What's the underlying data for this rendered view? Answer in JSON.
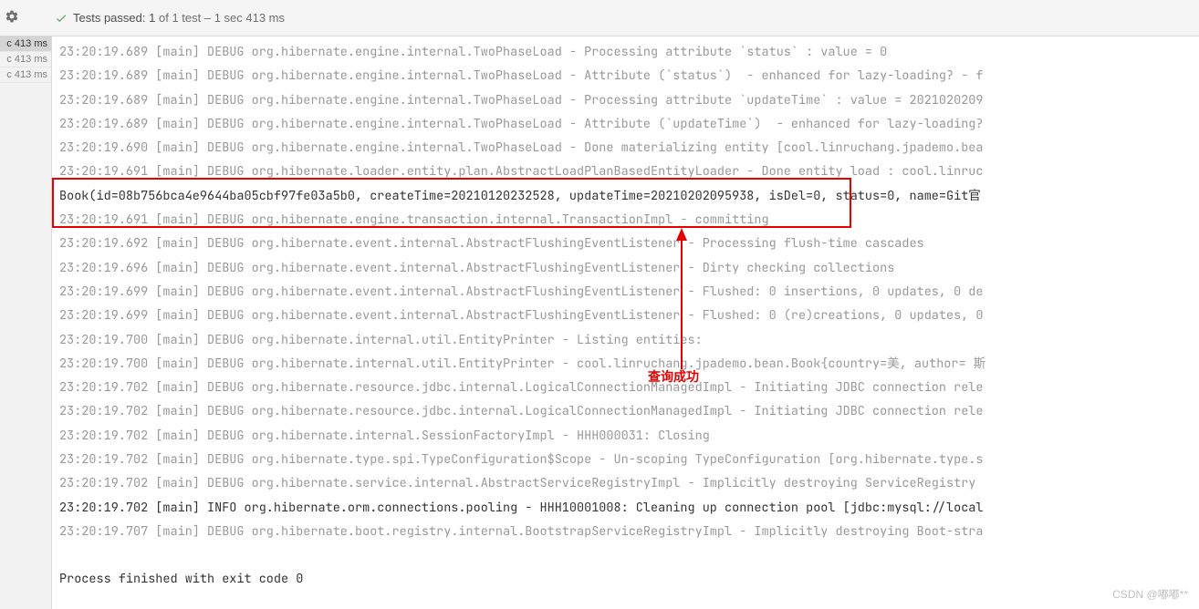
{
  "toolbar": {
    "tests_passed_prefix": "Tests passed:",
    "tests_passed_count": "1",
    "tests_passed_of": "of 1 test",
    "tests_passed_time": "– 1 sec 413 ms"
  },
  "sidebar": {
    "items": [
      {
        "label": "c 413 ms",
        "selected": true
      },
      {
        "label": "c 413 ms",
        "selected": false
      },
      {
        "label": "c 413 ms",
        "selected": false
      }
    ]
  },
  "annotation": {
    "label": "查询成功"
  },
  "watermark": "CSDN @嘟嘟**",
  "log_lines": [
    {
      "text": "23:20:19.689 [main] DEBUG org.hibernate.engine.internal.TwoPhaseLoad - Processing attribute `status` : value = 0",
      "class": ""
    },
    {
      "text": "23:20:19.689 [main] DEBUG org.hibernate.engine.internal.TwoPhaseLoad - Attribute (`status`)  - enhanced for lazy-loading? - f",
      "class": ""
    },
    {
      "text": "23:20:19.689 [main] DEBUG org.hibernate.engine.internal.TwoPhaseLoad - Processing attribute `updateTime` : value = 2021020209",
      "class": ""
    },
    {
      "text": "23:20:19.689 [main] DEBUG org.hibernate.engine.internal.TwoPhaseLoad - Attribute (`updateTime`)  - enhanced for lazy-loading?",
      "class": ""
    },
    {
      "text": "23:20:19.690 [main] DEBUG org.hibernate.engine.internal.TwoPhaseLoad - Done materializing entity [cool.linruchang.jpademo.bea",
      "class": ""
    },
    {
      "text": "23:20:19.691 [main] DEBUG org.hibernate.loader.entity.plan.AbstractLoadPlanBasedEntityLoader - Done entity load : cool.linruc",
      "class": ""
    },
    {
      "text": "Book(id=08b756bca4e9644ba05cbf97fe03a5b0, createTime=20210120232528, updateTime=20210202095938, isDel=0, status=0, name=Git官",
      "class": "black"
    },
    {
      "text": "23:20:19.691 [main] DEBUG org.hibernate.engine.transaction.internal.TransactionImpl - committing",
      "class": ""
    },
    {
      "text": "23:20:19.692 [main] DEBUG org.hibernate.event.internal.AbstractFlushingEventListener - Processing flush-time cascades",
      "class": ""
    },
    {
      "text": "23:20:19.696 [main] DEBUG org.hibernate.event.internal.AbstractFlushingEventListener - Dirty checking collections",
      "class": ""
    },
    {
      "text": "23:20:19.699 [main] DEBUG org.hibernate.event.internal.AbstractFlushingEventListener - Flushed: 0 insertions, 0 updates, 0 de",
      "class": ""
    },
    {
      "text": "23:20:19.699 [main] DEBUG org.hibernate.event.internal.AbstractFlushingEventListener - Flushed: 0 (re)creations, 0 updates, 0",
      "class": ""
    },
    {
      "text": "23:20:19.700 [main] DEBUG org.hibernate.internal.util.EntityPrinter - Listing entities:",
      "class": ""
    },
    {
      "text": "23:20:19.700 [main] DEBUG org.hibernate.internal.util.EntityPrinter - cool.linruchang.jpademo.bean.Book{country=美, author= 斯",
      "class": ""
    },
    {
      "text": "23:20:19.702 [main] DEBUG org.hibernate.resource.jdbc.internal.LogicalConnectionManagedImpl - Initiating JDBC connection rele",
      "class": ""
    },
    {
      "text": "23:20:19.702 [main] DEBUG org.hibernate.resource.jdbc.internal.LogicalConnectionManagedImpl - Initiating JDBC connection rele",
      "class": ""
    },
    {
      "text": "23:20:19.702 [main] DEBUG org.hibernate.internal.SessionFactoryImpl - HHH000031: Closing",
      "class": ""
    },
    {
      "text": "23:20:19.702 [main] DEBUG org.hibernate.type.spi.TypeConfiguration$Scope - Un-scoping TypeConfiguration [org.hibernate.type.s",
      "class": ""
    },
    {
      "text": "23:20:19.702 [main] DEBUG org.hibernate.service.internal.AbstractServiceRegistryImpl - Implicitly destroying ServiceRegistry ",
      "class": ""
    },
    {
      "text": "23:20:19.702 [main] INFO org.hibernate.orm.connections.pooling - HHH10001008: Cleaning up connection pool [jdbc:mysql://local",
      "class": "black"
    },
    {
      "text": "23:20:19.707 [main] DEBUG org.hibernate.boot.registry.internal.BootstrapServiceRegistryImpl - Implicitly destroying Boot-stra",
      "class": ""
    },
    {
      "text": "Process finished with exit code 0",
      "class": "exit"
    }
  ]
}
